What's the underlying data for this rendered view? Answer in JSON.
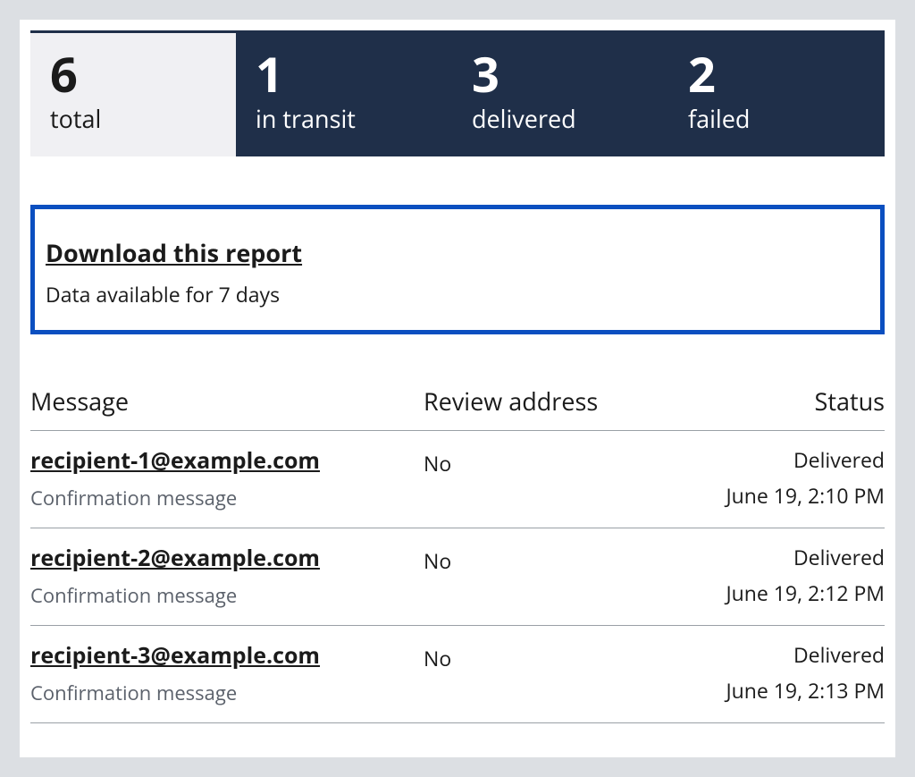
{
  "stats": [
    {
      "value": "6",
      "label": "total"
    },
    {
      "value": "1",
      "label": "in transit"
    },
    {
      "value": "3",
      "label": "delivered"
    },
    {
      "value": "2",
      "label": "failed"
    }
  ],
  "download": {
    "link_text": "Download this report",
    "note": "Data available for 7 days"
  },
  "table": {
    "headers": {
      "message": "Message",
      "review": "Review address",
      "status": "Status"
    },
    "rows": [
      {
        "email": "recipient-1@example.com",
        "subtitle": "Confirmation message",
        "review": "No",
        "status": "Delivered",
        "timestamp": "June 19, 2:10 PM"
      },
      {
        "email": "recipient-2@example.com",
        "subtitle": "Confirmation message",
        "review": "No",
        "status": "Delivered",
        "timestamp": "June 19, 2:12 PM"
      },
      {
        "email": "recipient-3@example.com",
        "subtitle": "Confirmation message",
        "review": "No",
        "status": "Delivered",
        "timestamp": "June 19, 2:13 PM"
      }
    ]
  }
}
